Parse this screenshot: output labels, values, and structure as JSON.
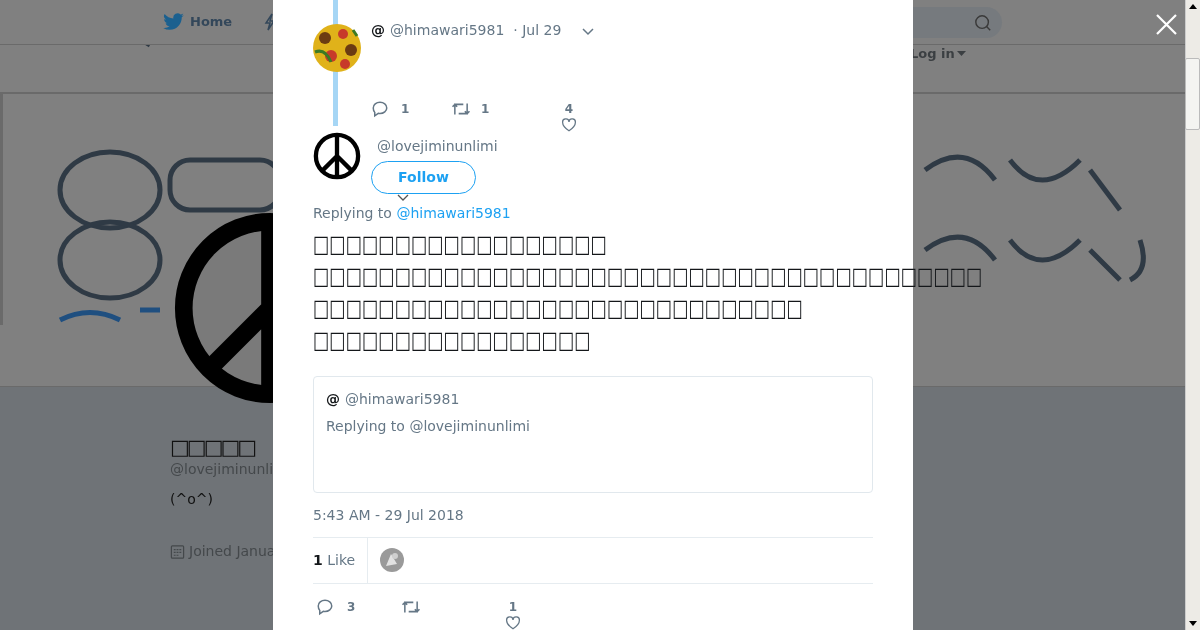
{
  "header": {
    "nav": [
      {
        "label": "Home"
      }
    ],
    "login": "Log in"
  },
  "profile": {
    "name": "□□□□□",
    "handle": "@lovejiminunli",
    "bio": "(^o^)",
    "joined": "Joined Janua"
  },
  "modal": {
    "parent_tweet": {
      "name": "@",
      "handle": "@himawari5981",
      "date": "· Jul 29",
      "replies": "1",
      "retweets": "1",
      "likes": "4"
    },
    "tweet": {
      "handle": "@lovejiminunlimi",
      "follow": "Follow",
      "replying_label": "Replying to",
      "replying_to": "@himawari5981",
      "text": "□□□□□□□□□□□□□□□□□□\n□□□□□□□□□□□□□□□□□□□□□□□□□□□□□□□□□□□□□□□□□\n□□□□□□□□□□□□□□□□□□□□□□□□□□□□□□\n□□□□□□□□□□□□□□□□□",
      "quote": {
        "name": "@",
        "handle": "@himawari5981",
        "replying": "Replying to @lovejiminunlimi"
      },
      "timestamp": "5:43 AM - 29 Jul 2018",
      "like_count": "1",
      "like_label": "Like",
      "replies": "3",
      "likes": "1"
    }
  }
}
